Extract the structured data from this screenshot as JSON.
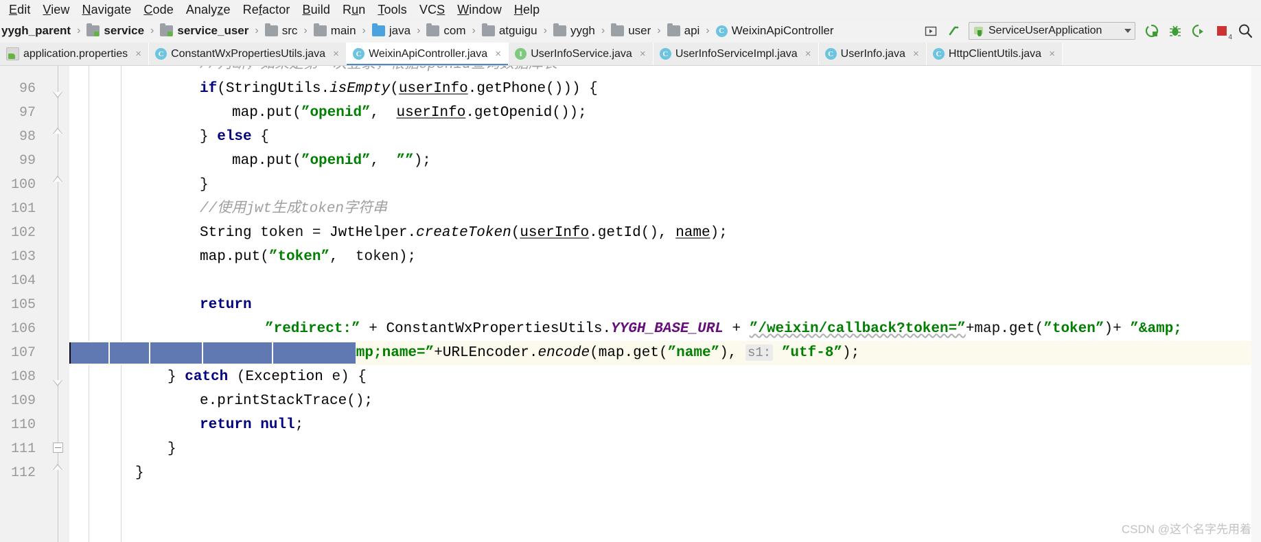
{
  "window": {
    "ide": "IntelliJ IDEA",
    "menu": [
      {
        "label": "Edit",
        "mnemonic": "E"
      },
      {
        "label": "View",
        "mnemonic": "V"
      },
      {
        "label": "Navigate",
        "mnemonic": "N"
      },
      {
        "label": "Code",
        "mnemonic": "C"
      },
      {
        "label": "Analyze",
        "mnemonic": "z"
      },
      {
        "label": "Refactor",
        "mnemonic": "f"
      },
      {
        "label": "Build",
        "mnemonic": "B"
      },
      {
        "label": "Run",
        "mnemonic": "u"
      },
      {
        "label": "Tools",
        "mnemonic": "T"
      },
      {
        "label": "VCS",
        "mnemonic": "S"
      },
      {
        "label": "Window",
        "mnemonic": "W"
      },
      {
        "label": "Help",
        "mnemonic": "H"
      }
    ]
  },
  "breadcrumb": {
    "separator": "›",
    "items": [
      {
        "label": "yygh_parent",
        "icon": "project-icon",
        "bold": true,
        "icon_kind": "none"
      },
      {
        "label": "service",
        "icon": "module-icon",
        "bold": true,
        "icon_kind": "module-green"
      },
      {
        "label": "service_user",
        "icon": "module-icon",
        "bold": true,
        "icon_kind": "module-green"
      },
      {
        "label": "src",
        "icon": "folder-icon",
        "bold": false,
        "icon_kind": "folder"
      },
      {
        "label": "main",
        "icon": "folder-icon",
        "bold": false,
        "icon_kind": "folder"
      },
      {
        "label": "java",
        "icon": "source-root-folder-icon",
        "bold": false,
        "icon_kind": "folder-blue"
      },
      {
        "label": "com",
        "icon": "folder-icon",
        "bold": false,
        "icon_kind": "folder"
      },
      {
        "label": "atguigu",
        "icon": "folder-icon",
        "bold": false,
        "icon_kind": "folder"
      },
      {
        "label": "yygh",
        "icon": "folder-icon",
        "bold": false,
        "icon_kind": "folder"
      },
      {
        "label": "user",
        "icon": "folder-icon",
        "bold": false,
        "icon_kind": "folder"
      },
      {
        "label": "api",
        "icon": "folder-icon",
        "bold": false,
        "icon_kind": "folder"
      },
      {
        "label": "WeixinApiController",
        "icon": "java-class-icon",
        "bold": false,
        "icon_kind": "class"
      }
    ]
  },
  "toolbar": {
    "select_in_project_label": "",
    "build_label": "",
    "run_configuration": "ServiceUserApplication",
    "run_config_dropdown_arrow": "▾",
    "buttons": [
      {
        "name": "select-opened-file-button",
        "glyph": "▣"
      },
      {
        "name": "build-project-button",
        "glyph": "↖"
      },
      {
        "name": "run-button",
        "glyph": "▶"
      },
      {
        "name": "debug-button",
        "glyph": "🐞"
      },
      {
        "name": "run-with-coverage-button",
        "glyph": "▷"
      },
      {
        "name": "stop-button",
        "glyph": "■"
      },
      {
        "name": "search-everywhere-button",
        "glyph": "🔍"
      }
    ],
    "stop_badge": "4"
  },
  "tabs": [
    {
      "label": "application.properties",
      "icon": "properties-file-icon",
      "icon_kind": "props",
      "active": false,
      "close": "×"
    },
    {
      "label": "ConstantWxPropertiesUtils.java",
      "icon": "java-class-icon",
      "icon_kind": "class",
      "active": false,
      "close": "×"
    },
    {
      "label": "WeixinApiController.java",
      "icon": "java-class-icon",
      "icon_kind": "class",
      "active": true,
      "close": "×"
    },
    {
      "label": "UserInfoService.java",
      "icon": "java-interface-icon",
      "icon_kind": "interface",
      "active": false,
      "close": "×"
    },
    {
      "label": "UserInfoServiceImpl.java",
      "icon": "java-class-icon",
      "icon_kind": "class",
      "active": false,
      "close": "×"
    },
    {
      "label": "UserInfo.java",
      "icon": "java-class-icon",
      "icon_kind": "class",
      "active": false,
      "close": "×"
    },
    {
      "label": "HttpClientUtils.java",
      "icon": "java-class-icon",
      "icon_kind": "class",
      "active": false,
      "close": "×"
    }
  ],
  "editor": {
    "file": "WeixinApiController.java",
    "first_visible_line": 95,
    "caret_line": 107,
    "line_numbers": [
      "96",
      "97",
      "98",
      "99",
      "100",
      "101",
      "102",
      "103",
      "104",
      "105",
      "106",
      "107",
      "108",
      "109",
      "110",
      "111",
      "112"
    ],
    "partial_top_comment": "//判断，如果是第一次登录，根据openid查询数据库表",
    "lines": [
      {
        "n": "96",
        "code": "if(StringUtils.isEmpty(userInfo.getPhone())) {"
      },
      {
        "n": "97",
        "code": "    map.put(\"openid\", userInfo.getOpenid());"
      },
      {
        "n": "98",
        "code": "} else {"
      },
      {
        "n": "99",
        "code": "    map.put(\"openid\", \"\");"
      },
      {
        "n": "100",
        "code": "}"
      },
      {
        "n": "101",
        "code": "//使用jwt生成token字符串"
      },
      {
        "n": "102",
        "code": "String token = JwtHelper.createToken(userInfo.getId(), name);"
      },
      {
        "n": "103",
        "code": "map.put(\"token\", token);"
      },
      {
        "n": "104",
        "code": ""
      },
      {
        "n": "105",
        "code": "return"
      },
      {
        "n": "106",
        "code": "    \"redirect:\" + ConstantWxPropertiesUtils.YYGH_BASE_URL + \"/weixin/callback?token=\"+map.get(\"token\")+ \"&"
      },
      {
        "n": "107",
        "code": "            \"&name=\"+URLEncoder.encode(map.get(\"name\"), s1: \"utf-8\");"
      },
      {
        "n": "108",
        "code": "} catch (Exception e) {"
      },
      {
        "n": "109",
        "code": "    e.printStackTrace();"
      },
      {
        "n": "110",
        "code": "    return null;"
      },
      {
        "n": "111",
        "code": "}"
      },
      {
        "n": "112",
        "code": "}"
      }
    ],
    "parameter_hint": "s1:",
    "selection_line": "107"
  },
  "watermark": "CSDN @这个名字先用着",
  "colors": {
    "keyword": "#000080",
    "string": "#008000",
    "comment": "#a0a0a0",
    "static_field": "#660e7a",
    "selection": "#6079b3",
    "caret_line": "#fcfaed",
    "active_tab_underline": "#4a88c7"
  }
}
